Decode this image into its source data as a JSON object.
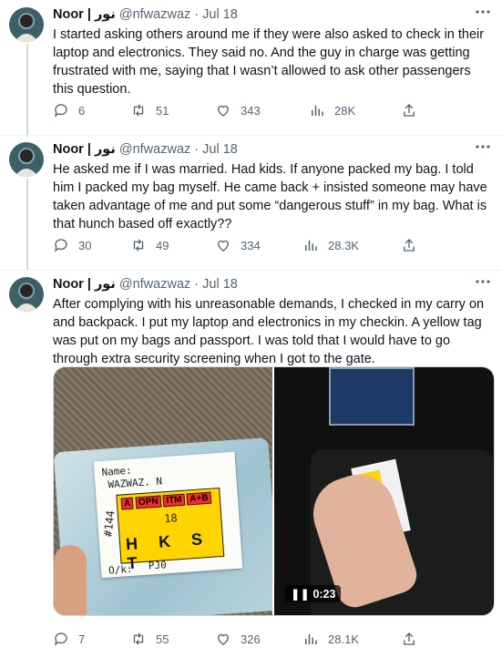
{
  "tweets": [
    {
      "name": "Noor | نور",
      "handle": "@nfwazwaz",
      "dot": "·",
      "date": "Jul 18",
      "text": "I started asking others around me if they were also asked to check in their laptop and electronics. They said no. And the guy in charge was getting frustrated with me, saying that I wasn’t allowed to ask other passengers this question.",
      "replies": "6",
      "retweets": "51",
      "likes": "343",
      "views": "28K"
    },
    {
      "name": "Noor | نور",
      "handle": "@nfwazwaz",
      "dot": "·",
      "date": "Jul 18",
      "text": "He asked me if I was married. Had kids. If anyone packed my bag. I told him I packed my bag myself. He came back + insisted someone may have taken advantage of me and put some “dangerous stuff” in my bag. What is that hunch based off exactly??",
      "replies": "30",
      "retweets": "49",
      "likes": "334",
      "views": "28.3K"
    },
    {
      "name": "Noor | نور",
      "handle": "@nfwazwaz",
      "dot": "·",
      "date": "Jul 18",
      "text": "After complying with his unreasonable demands, I checked in my carry on and backpack. I put my laptop and electronics in my checkin. A yellow tag was put on my bags and passport. I was told that I would have to go through extra security screening when I got to the gate.",
      "replies": "7",
      "retweets": "55",
      "likes": "326",
      "views": "28.1K",
      "media": {
        "photo_tag": {
          "name_label": "Name:",
          "name_value": "WAZWAZ. N",
          "codes": [
            "A",
            "OPN",
            "ITM",
            "A+B"
          ],
          "number": "18",
          "letters": "H K S T",
          "side_mark": "#144",
          "ok_label": "O/k:",
          "ok_value": "PJ0"
        },
        "video_time": "0:23"
      }
    }
  ],
  "icons": {
    "more": "more-icon",
    "reply": "reply-icon",
    "retweet": "retweet-icon",
    "like": "heart-icon",
    "views": "views-icon",
    "share": "share-icon",
    "pause": "pause-icon"
  },
  "colors": {
    "text": "#0f1419",
    "muted": "#536471",
    "line": "#cfd9de",
    "tag_yellow": "#ffd400"
  }
}
